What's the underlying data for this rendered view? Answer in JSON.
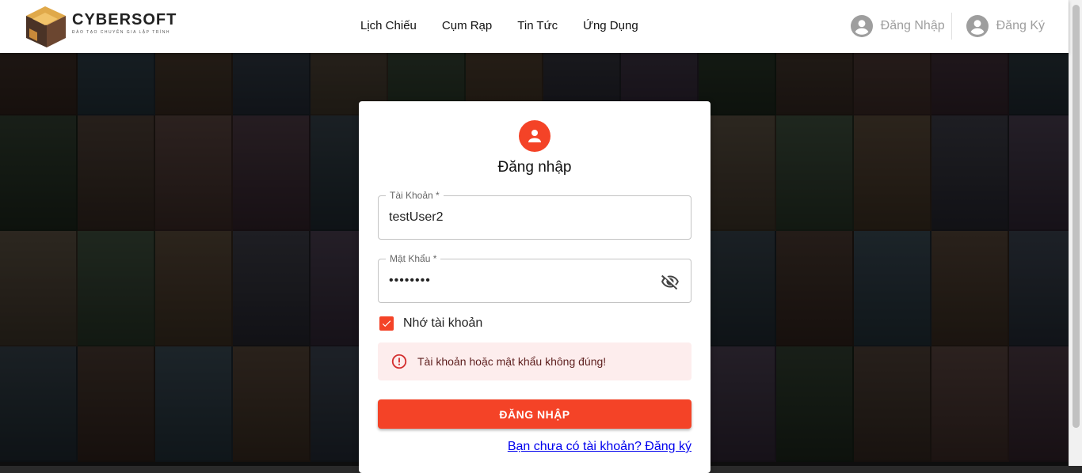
{
  "header": {
    "logo": {
      "title": "CYBERSOFT",
      "subtitle": "ĐÀO TẠO CHUYÊN GIA LẬP TRÌNH"
    },
    "nav": [
      "Lịch Chiếu",
      "Cụm Rạp",
      "Tin Tức",
      "Ứng Dụng"
    ],
    "login_label": "Đăng Nhập",
    "register_label": "Đăng Ký"
  },
  "login_form": {
    "title": "Đăng nhập",
    "username": {
      "label": "Tài Khoản *",
      "value": "testUser2"
    },
    "password": {
      "label": "Mật Khẩu *",
      "value": "••••••••"
    },
    "remember": {
      "label": "Nhớ tài khoản",
      "checked": true
    },
    "error_message": "Tài khoản hoặc mật khẩu không đúng!",
    "submit_label": "ĐĂNG NHẬP",
    "register_link": "Bạn chưa có tài khoản? Đăng ký"
  },
  "colors": {
    "accent": "#f44327",
    "error_bg": "#fdeded",
    "error_text": "#5f2120",
    "link": "#0000ee"
  },
  "icons": {
    "user_avatar": "person-icon",
    "login_account": "account-circle-icon",
    "register_account": "account-circle-icon",
    "toggle_password": "eye-off-icon",
    "remember_checkbox": "check-icon",
    "error": "error-outline-icon"
  }
}
